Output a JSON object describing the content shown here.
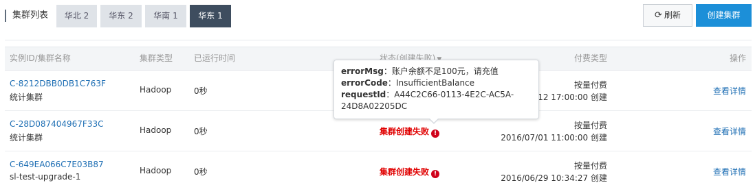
{
  "header": {
    "title": "集群列表",
    "region_tabs": [
      {
        "label": "华北 2",
        "active": false
      },
      {
        "label": "华东 2",
        "active": false
      },
      {
        "label": "华南 1",
        "active": false
      },
      {
        "label": "华东 1",
        "active": true
      }
    ],
    "refresh_label": "刷新",
    "create_label": "创建集群"
  },
  "table": {
    "columns": [
      "实例ID/集群名称",
      "集群类型",
      "已运行时间",
      "状态(创建失败)",
      "付费类型",
      "操作"
    ],
    "rows": [
      {
        "id": "C-8212DBB0DB1C763F",
        "name": "统计集群",
        "type": "Hadoop",
        "runtime": "0秒",
        "status": "",
        "billing": "按量付费",
        "created": "2016/07/12 17:00:00 创建",
        "action": "查看详情"
      },
      {
        "id": "C-28D087404967F33C",
        "name": "统计集群",
        "type": "Hadoop",
        "runtime": "0秒",
        "status": "集群创建失败",
        "billing": "按量付费",
        "created": "2016/07/01 11:00:00 创建",
        "action": "查看详情"
      },
      {
        "id": "C-649EA066C7E03B87",
        "name": "sl-test-upgrade-1",
        "type": "Hadoop",
        "runtime": "0秒",
        "status": "集群创建失败",
        "billing": "按量付费",
        "created": "2016/06/29 10:34:27 创建",
        "action": "查看详情"
      }
    ]
  },
  "tooltip": {
    "error_msg_key": "errorMsg",
    "error_msg_value": "账户余额不足100元，请充值",
    "error_code_key": "errorCode",
    "error_code_value": "InsufficientBalance",
    "request_id_key": "requestId",
    "request_id_value": "A44C2C66-0113-4E2C-AC5A-24D8A02205DC"
  },
  "icons": {
    "refresh": "refresh-icon",
    "error": "error-icon",
    "sort_caret": "caret-down-icon"
  },
  "colors": {
    "active_tab": "#3e4d5f",
    "primary": "#1c8fd8",
    "link": "#1f6fb4",
    "error": "#e00000"
  }
}
